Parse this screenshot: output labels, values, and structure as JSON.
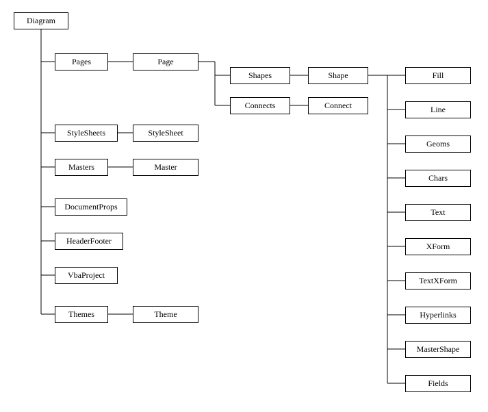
{
  "nodes": {
    "diagram": "Diagram",
    "pages": "Pages",
    "page": "Page",
    "shapes": "Shapes",
    "shape": "Shape",
    "connects": "Connects",
    "connect": "Connect",
    "stylesheets": "StyleSheets",
    "stylesheet": "StyleSheet",
    "masters": "Masters",
    "master": "Master",
    "documentprops": "DocumentProps",
    "headerfooter": "HeaderFooter",
    "vbaproject": "VbaProject",
    "themes": "Themes",
    "theme": "Theme",
    "fill": "Fill",
    "line": "Line",
    "geoms": "Geoms",
    "chars": "Chars",
    "text": "Text",
    "xform": "XForm",
    "textxform": "TextXForm",
    "hyperlinks": "Hyperlinks",
    "mastershape": "MasterShape",
    "fields": "Fields"
  },
  "hierarchy": {
    "root": "Diagram",
    "children": [
      {
        "name": "Pages",
        "children": [
          {
            "name": "Page",
            "children": [
              {
                "name": "Shapes",
                "children": [
                  {
                    "name": "Shape",
                    "children": [
                      "Fill",
                      "Line",
                      "Geoms",
                      "Chars",
                      "Text",
                      "XForm",
                      "TextXForm",
                      "Hyperlinks",
                      "MasterShape",
                      "Fields"
                    ]
                  }
                ]
              },
              {
                "name": "Connects",
                "children": [
                  "Connect"
                ]
              }
            ]
          }
        ]
      },
      {
        "name": "StyleSheets",
        "children": [
          "StyleSheet"
        ]
      },
      {
        "name": "Masters",
        "children": [
          "Master"
        ]
      },
      {
        "name": "DocumentProps"
      },
      {
        "name": "HeaderFooter"
      },
      {
        "name": "VbaProject"
      },
      {
        "name": "Themes",
        "children": [
          "Theme"
        ]
      }
    ]
  }
}
